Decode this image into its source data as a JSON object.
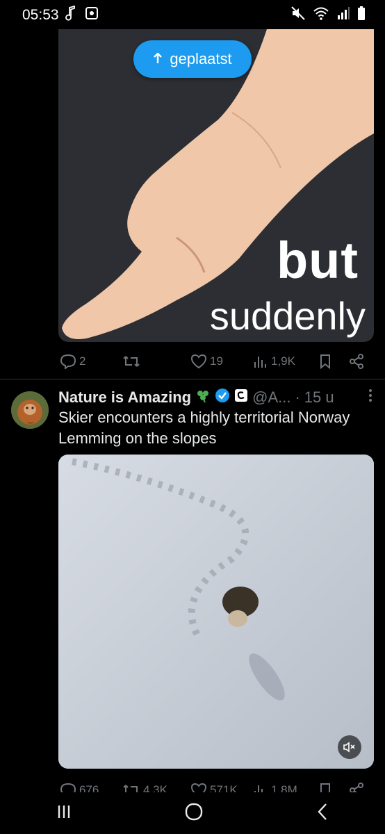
{
  "status_bar": {
    "time": "05:53"
  },
  "posted_pill": {
    "label": "geplaatst"
  },
  "meme": {
    "line1": "but",
    "line2": "suddenly"
  },
  "first_tweet_actions": {
    "replies": "2",
    "reposts": "",
    "likes": "19",
    "views": "1,9K"
  },
  "second_tweet": {
    "author": "Nature is Amazing",
    "handle": "@A...",
    "separator": "·",
    "time": "15 u",
    "text": "Skier encounters a highly territorial Norway Lemming on the slopes",
    "actions": {
      "replies": "676",
      "reposts": "4,3K",
      "likes": "571K",
      "views": "1,8M"
    }
  },
  "colors": {
    "accent": "#1d9bf0",
    "muted": "#71767b",
    "verified": "#1d9bf0"
  }
}
